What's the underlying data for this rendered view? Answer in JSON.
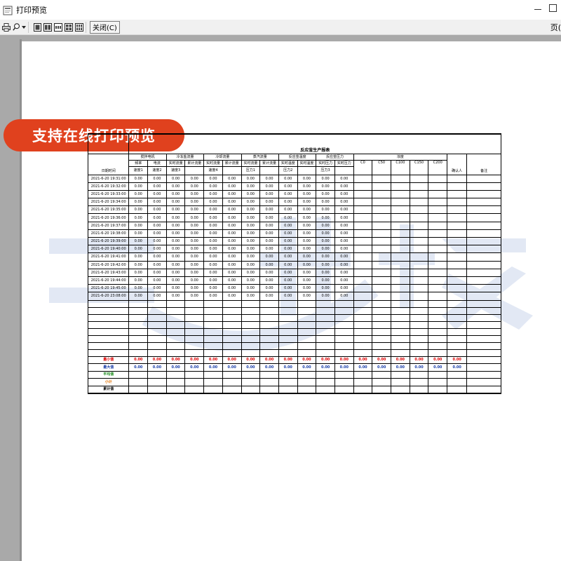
{
  "window": {
    "title": "打印预览",
    "colors": {
      "titlebar": "#ffffff",
      "preview_bg": "#a9a9a9",
      "banner": "#e0411e"
    }
  },
  "toolbar": {
    "icons": [
      "printer-icon",
      "zoom-icon",
      "one-page-icon",
      "two-page-icon",
      "three-page-icon",
      "four-page-icon",
      "six-page-icon"
    ],
    "close_label": "关闭(C)",
    "page_label": "页("
  },
  "banner": {
    "text": "支持在线打印预览"
  },
  "report": {
    "title": "反应釜生产报表",
    "time_header": "日期时间",
    "groups": [
      {
        "name": "搅拌电机",
        "sub": [
          "频率",
          "电流"
        ],
        "units": [
          "速度1",
          "速度2"
        ]
      },
      {
        "name": "冷冻盐流量",
        "sub": [
          "实时流量",
          "累计流量"
        ],
        "units": [
          "速度3",
          ""
        ]
      },
      {
        "name": "冷却流量",
        "sub": [
          "实时流量",
          "累计流量"
        ],
        "units": [
          "速度4",
          ""
        ]
      },
      {
        "name": "蒸汽流量",
        "sub": [
          "实时流量",
          "累计流量"
        ],
        "units": [
          "压力1",
          ""
        ]
      },
      {
        "name": "反应釜温度",
        "sub": [
          "实时温度",
          "实时温度"
        ],
        "units": [
          "压力2",
          ""
        ]
      },
      {
        "name": "反应釜压力",
        "sub": [
          "实时压力",
          "实时压力"
        ],
        "units": [
          "压力3",
          ""
        ]
      }
    ],
    "conc_group": {
      "name": "浓度",
      "cols": [
        "C0",
        "C50",
        "C100",
        "C150",
        "C200"
      ]
    },
    "confirm_header": "确认人",
    "note_header": "备注",
    "times": [
      "2021-6-20 19:31:00",
      "2021-6-20 19:32:00",
      "2021-6-20 19:33:00",
      "2021-6-20 19:34:00",
      "2021-6-20 19:35:00",
      "2021-6-20 19:36:00",
      "2021-6-20 19:37:00",
      "2021-6-20 19:38:00",
      "2021-6-20 19:39:00",
      "2021-6-20 19:40:00",
      "2021-6-20 19:41:00",
      "2021-6-20 19:42:00",
      "2021-6-20 19:43:00",
      "2021-6-20 19:44:00",
      "2021-6-20 19:45:00",
      "2021-6-20 23:08:00"
    ],
    "cell_value": "0.00",
    "value_col_count": 12,
    "empty_rows": 8,
    "summary": [
      {
        "label": "最小值",
        "color": "red",
        "filled": true
      },
      {
        "label": "最大值",
        "color": "blue",
        "filled": true
      },
      {
        "label": "平均值",
        "color": "green",
        "filled": false
      },
      {
        "label": "小计",
        "color": "orange",
        "filled": false
      },
      {
        "label": "累计值",
        "color": "black",
        "filled": false
      }
    ],
    "summary_fill_cols": 18
  }
}
